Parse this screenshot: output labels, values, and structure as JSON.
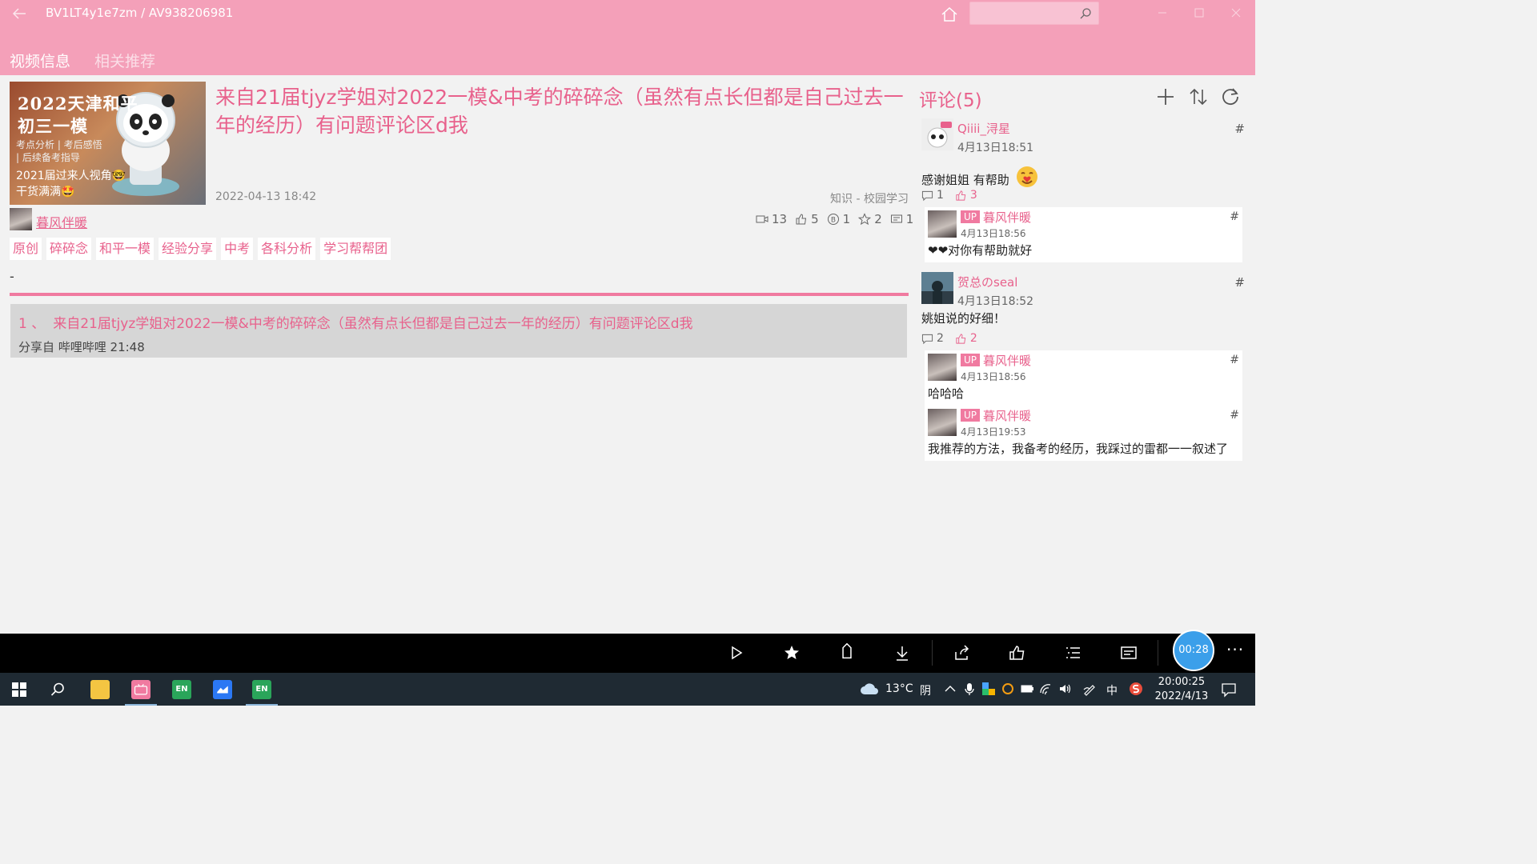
{
  "titlebar": {
    "title": "BV1LT4y1e7zm / AV938206981",
    "search_placeholder": ""
  },
  "tabs": [
    {
      "label": "视频信息",
      "active": true
    },
    {
      "label": "相关推荐",
      "active": false
    }
  ],
  "video": {
    "thumbnail": {
      "line1": "2022天津和平",
      "line2": "初三一模",
      "line3": "考点分析 | 考后感悟",
      "line4": "| 后续备考指导",
      "line5": "2021届过来人视角🤓",
      "line6": "干货满满🤩"
    },
    "title": "来自21届tjyz学姐对2022一模&中考的碎碎念（虽然有点长但都是自己过去一年的经历）有问题评论区d我",
    "date": "2022-04-13 18:42",
    "category": "知识 - 校园学习",
    "author": "暮风伴暖",
    "stats": {
      "views": "13",
      "likes": "5",
      "coins": "1",
      "favorites": "2",
      "danmaku": "1"
    },
    "tags": [
      "原创",
      "碎碎念",
      "和平一模",
      "经验分享",
      "中考",
      "各科分析",
      "学习帮帮团"
    ],
    "description": "-",
    "part": {
      "index": "1 、",
      "title": "来自21届tjyz学姐对2022一模&中考的碎碎念（虽然有点长但都是自己过去一年的经历）有问题评论区d我",
      "source": "分享自 哔哩哔哩 21:48"
    }
  },
  "comments": {
    "header": "评论(5)",
    "items": [
      {
        "name": "Qiiii_浔星",
        "time": "4月13日18:51",
        "text": "感谢姐姐 有帮助",
        "replies_count": "1",
        "likes": "3",
        "replies": [
          {
            "badge": "UP",
            "name": "暮风伴暖",
            "time": "4月13日18:56",
            "text": "❤❤对你有帮助就好"
          }
        ]
      },
      {
        "name": "贺总のseal",
        "time": "4月13日18:52",
        "text": "姚姐说的好细！",
        "replies_count": "2",
        "likes": "2",
        "replies": [
          {
            "badge": "UP",
            "name": "暮风伴暖",
            "time": "4月13日18:56",
            "text": "哈哈哈"
          },
          {
            "badge": "UP",
            "name": "暮风伴暖",
            "time": "4月13日19:53",
            "text": "我推荐的方法，我备考的经历，我踩过的雷都一一叙述了"
          }
        ]
      }
    ],
    "hash": "#"
  },
  "cmdbar": {
    "timer": "00:28",
    "more": "···"
  },
  "taskbar": {
    "weather_temp": "13°C",
    "weather_desc": "阴",
    "ime": "中",
    "time": "20:00:25",
    "date": "2022/4/13",
    "app_en1": "EN",
    "app_en2": "EN"
  },
  "colors": {
    "accent": "#e8618c",
    "titlebar": "#f4a0b9",
    "divider": "#f07aa0",
    "timer": "#3b9fea"
  }
}
